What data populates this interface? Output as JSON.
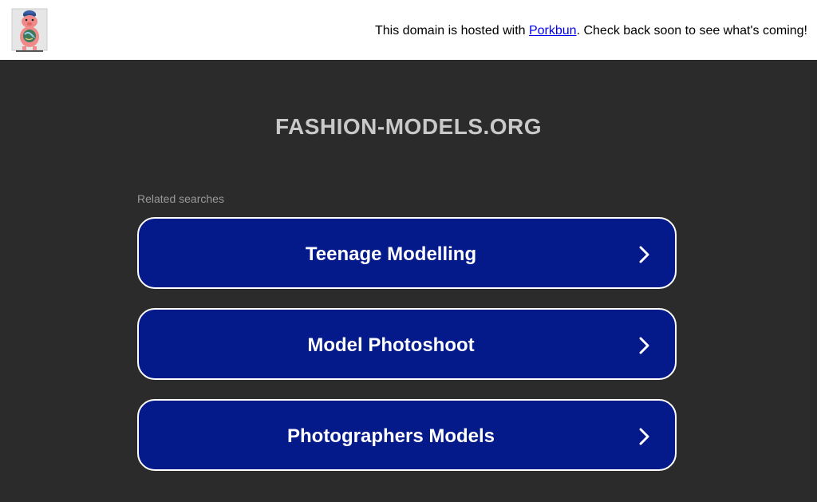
{
  "header": {
    "hosted_prefix": "This domain is hosted with ",
    "hosted_link": "Porkbun",
    "hosted_suffix": ". Check back soon to see what's coming!",
    "logo_icon": "porkbun-pig-logo-icon"
  },
  "main": {
    "domain": "FASHION-MODELS.ORG",
    "related_label": "Related searches",
    "searches": [
      {
        "label": "Teenage Modelling"
      },
      {
        "label": "Model Photoshoot"
      },
      {
        "label": "Photographers Models"
      }
    ]
  },
  "colors": {
    "background": "#2b2b2b",
    "button": "#041a8a",
    "button_border": "#ffffff",
    "title": "#c9c9c9",
    "link": "#0000ee"
  }
}
